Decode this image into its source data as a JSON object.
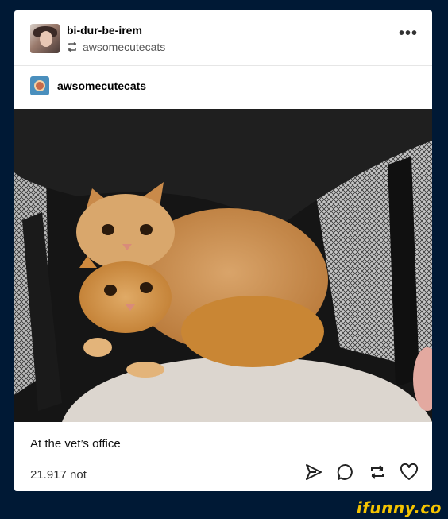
{
  "post": {
    "username": "bi-dur-be-irem",
    "reblogged_from": "awsomecutecats",
    "more_icon": "more-horizontal-icon",
    "source_name": "awsomecutecats",
    "caption": "At the vet’s office",
    "notes": "21.917 not"
  },
  "actions": [
    {
      "name": "share",
      "icon": "send-icon"
    },
    {
      "name": "reply",
      "icon": "comment-icon"
    },
    {
      "name": "reblog",
      "icon": "reblog-icon"
    },
    {
      "name": "like",
      "icon": "heart-icon"
    }
  ],
  "watermark": "ifunny.co",
  "colors": {
    "background": "#001935",
    "card": "#ffffff",
    "watermark": "#f5c400"
  }
}
